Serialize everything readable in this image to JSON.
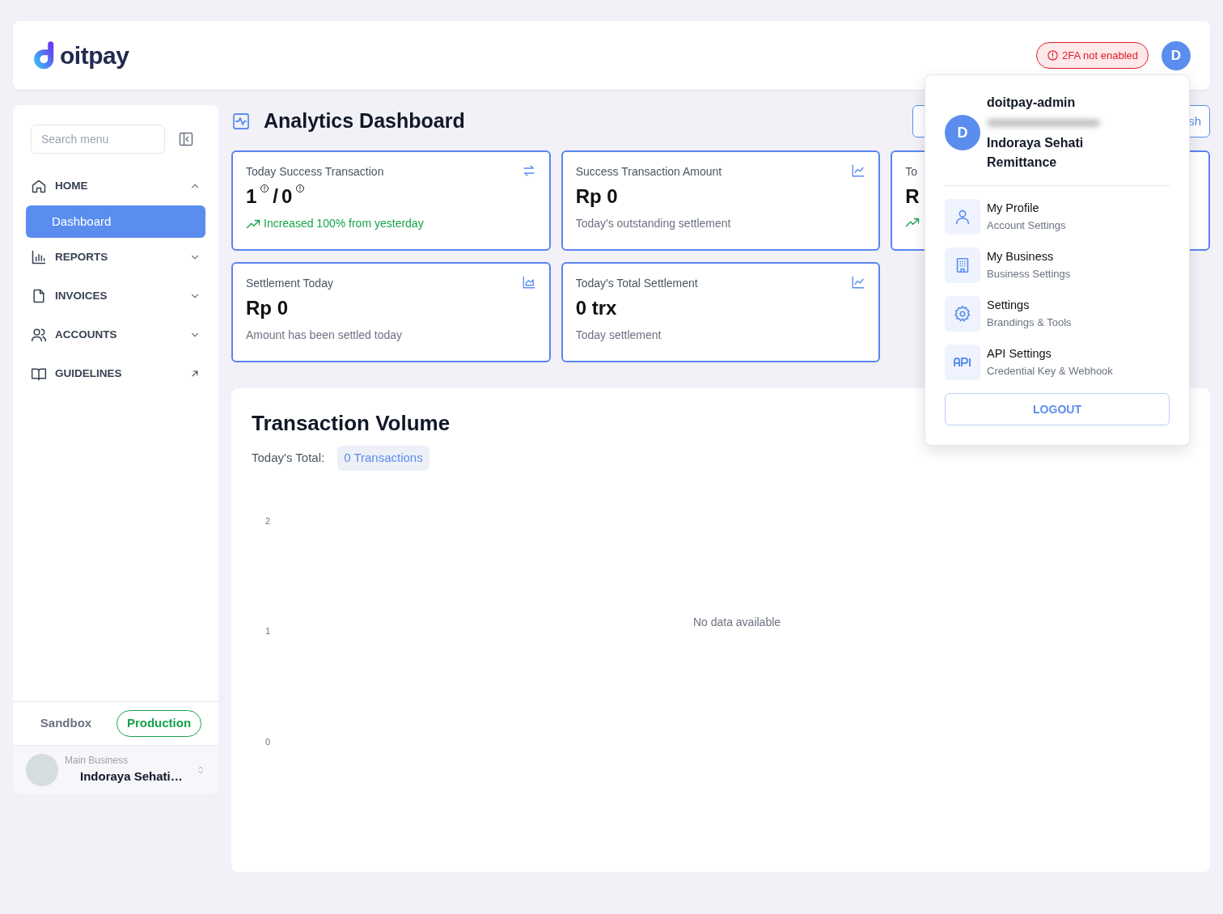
{
  "header": {
    "logo_text": "oitpay",
    "twofa_badge": "2FA not enabled",
    "avatar_letter": "D"
  },
  "sidebar": {
    "search_placeholder": "Search menu",
    "items": [
      {
        "label": "HOME",
        "kind": "group",
        "expanded": true,
        "children": [
          {
            "label": "Dashboard",
            "selected": true
          }
        ]
      },
      {
        "label": "REPORTS",
        "kind": "group",
        "expanded": false
      },
      {
        "label": "INVOICES",
        "kind": "group",
        "expanded": false
      },
      {
        "label": "ACCOUNTS",
        "kind": "group",
        "expanded": false
      },
      {
        "label": "GUIDELINES",
        "kind": "external"
      }
    ],
    "environments": [
      {
        "label": "Sandbox",
        "selected": false
      },
      {
        "label": "Production",
        "selected": true
      }
    ],
    "business": {
      "caption": "Main Business",
      "name": "Indoraya Sehati…"
    }
  },
  "page": {
    "title": "Analytics Dashboard",
    "top_button": "sh"
  },
  "stat_cards": [
    {
      "title": "Today Success Transaction",
      "kind": "ratio",
      "values": [
        "1",
        "0"
      ],
      "separator": "/",
      "note": "Increased 100% from yesterday",
      "trend": true
    },
    {
      "title": "Success Transaction Amount",
      "kind": "plain",
      "value": "Rp 0",
      "note": "Today's outstanding settlement",
      "trend": false
    },
    {
      "title": "To",
      "kind": "plain",
      "value": "R",
      "trend": true
    },
    {
      "title": "Settlement Today",
      "kind": "plain",
      "value": "Rp 0",
      "note": "Amount has been settled today",
      "trend": false
    },
    {
      "title": "Today's Total Settlement",
      "kind": "plain",
      "value": "0 trx",
      "note": "Today settlement",
      "trend": false
    }
  ],
  "volume": {
    "title": "Transaction Volume",
    "total_label": "Today's Total:",
    "total_value": "0 Transactions",
    "y_ticks": [
      "2",
      "1",
      "0"
    ],
    "empty_message": "No data available"
  },
  "user_menu": {
    "avatar_letter": "D",
    "username": "doitpay-admin",
    "business": "Indoraya Sehati Remittance",
    "items": [
      {
        "title": "My Profile",
        "subtitle": "Account Settings"
      },
      {
        "title": "My Business",
        "subtitle": "Business Settings"
      },
      {
        "title": "Settings",
        "subtitle": "Brandings & Tools"
      },
      {
        "title": "API Settings",
        "subtitle": "Credential Key & Webhook"
      }
    ],
    "logout": "LOGOUT"
  }
}
